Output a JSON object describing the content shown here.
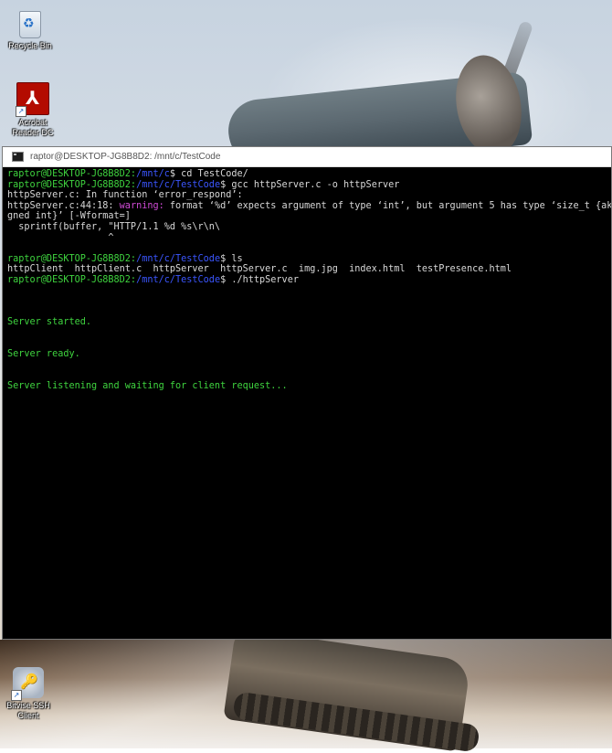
{
  "desktop": {
    "icons": [
      {
        "label_lines": [
          "Recycle Bin"
        ]
      },
      {
        "label_lines": [
          "Acrobat",
          "Reader DC"
        ]
      },
      {
        "label_lines": [
          "Bitvise SSH",
          "Client"
        ]
      }
    ]
  },
  "window": {
    "title": "raptor@DESKTOP-JG8B8D2: /mnt/c/TestCode"
  },
  "terminal": {
    "lines": [
      {
        "user": "raptor@DESKTOP-JG8B8D2:",
        "path": "/mnt/c",
        "cmd": "$ cd TestCode/"
      },
      {
        "user": "raptor@DESKTOP-JG8B8D2:",
        "path": "/mnt/c/TestCode",
        "cmd": "$ gcc httpServer.c -o httpServer"
      },
      {
        "text": "httpServer.c: In function ‘error_respond’:"
      },
      {
        "pre": "httpServer.c:44:18: ",
        "warn": "warning:",
        "post": " format ‘%d’ expects argument of type ‘int’, but argument 5 has type ‘size_t {aka long unsi"
      },
      {
        "text": "gned int}’ [-Wformat=]"
      },
      {
        "text": "  sprintf(buffer, \"HTTP/1.1 %d %s\\r\\n\\"
      },
      {
        "text": "                  ^"
      },
      {
        "text": ""
      },
      {
        "user": "raptor@DESKTOP-JG8B8D2:",
        "path": "/mnt/c/TestCode",
        "cmd": "$ ls"
      },
      {
        "text": "httpClient  httpClient.c  httpServer  httpServer.c  img.jpg  index.html  testPresence.html"
      },
      {
        "user": "raptor@DESKTOP-JG8B8D2:",
        "path": "/mnt/c/TestCode",
        "cmd": "$ ./httpServer"
      },
      {
        "text": ""
      },
      {
        "text": ""
      },
      {
        "text": ""
      },
      {
        "out": "Server started."
      },
      {
        "text": ""
      },
      {
        "text": ""
      },
      {
        "out": "Server ready."
      },
      {
        "text": ""
      },
      {
        "text": ""
      },
      {
        "out": "Server listening and waiting for client request..."
      }
    ]
  },
  "colors": {
    "prompt_user": "#3fd43f",
    "prompt_path": "#3b56ff",
    "warning": "#d04bd6",
    "server_output": "#3fd43f",
    "terminal_bg": "#000000"
  }
}
